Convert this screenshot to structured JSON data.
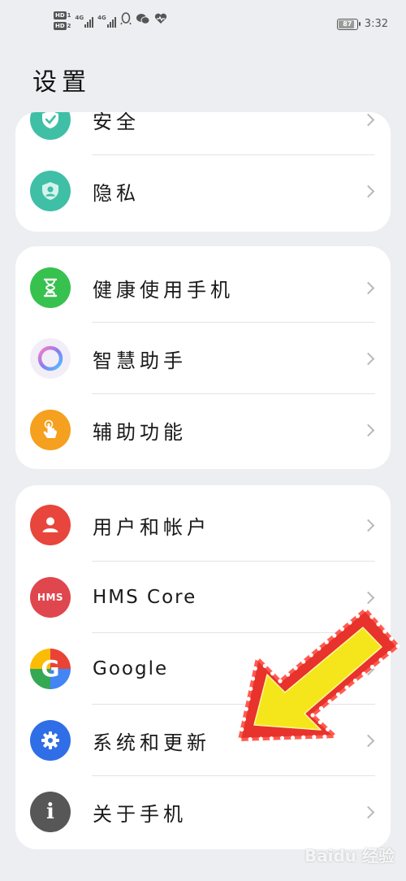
{
  "status_bar": {
    "hd1": "HD",
    "hd1_num": "1",
    "hd2": "HD",
    "hd2_num": "2",
    "net1": "4G",
    "net2": "4G",
    "battery": "87",
    "battery_level": 0.87,
    "time": "3:32"
  },
  "page": {
    "title": "设置"
  },
  "cards": [
    {
      "items": [
        {
          "label": "安全",
          "icon": "shield-check-icon",
          "color": "#3fbfa6"
        },
        {
          "label": "隐私",
          "icon": "shield-user-icon",
          "color": "#3fbfa6"
        }
      ]
    },
    {
      "items": [
        {
          "label": "健康使用手机",
          "icon": "hourglass-icon",
          "color": "#37c14e"
        },
        {
          "label": "智慧助手",
          "icon": "assistant-ring-icon",
          "color": "#8a7cf0"
        },
        {
          "label": "辅助功能",
          "icon": "hand-pointer-icon",
          "color": "#f5a01e"
        }
      ]
    },
    {
      "items": [
        {
          "label": "用户和帐户",
          "icon": "user-icon",
          "color": "#e8453c"
        },
        {
          "label": "HMS Core",
          "icon": "hms-icon",
          "color": "#e0464e"
        },
        {
          "label": "Google",
          "icon": "google-icon",
          "color": "#4285f4"
        },
        {
          "label": "系统和更新",
          "icon": "gear-icon",
          "color": "#2f6ee6"
        },
        {
          "label": "关于手机",
          "icon": "info-icon",
          "color": "#575757"
        }
      ]
    }
  ],
  "hms_badge": "HMS",
  "google_badge": "G",
  "info_badge": "i",
  "watermark": "Baidu 经验"
}
